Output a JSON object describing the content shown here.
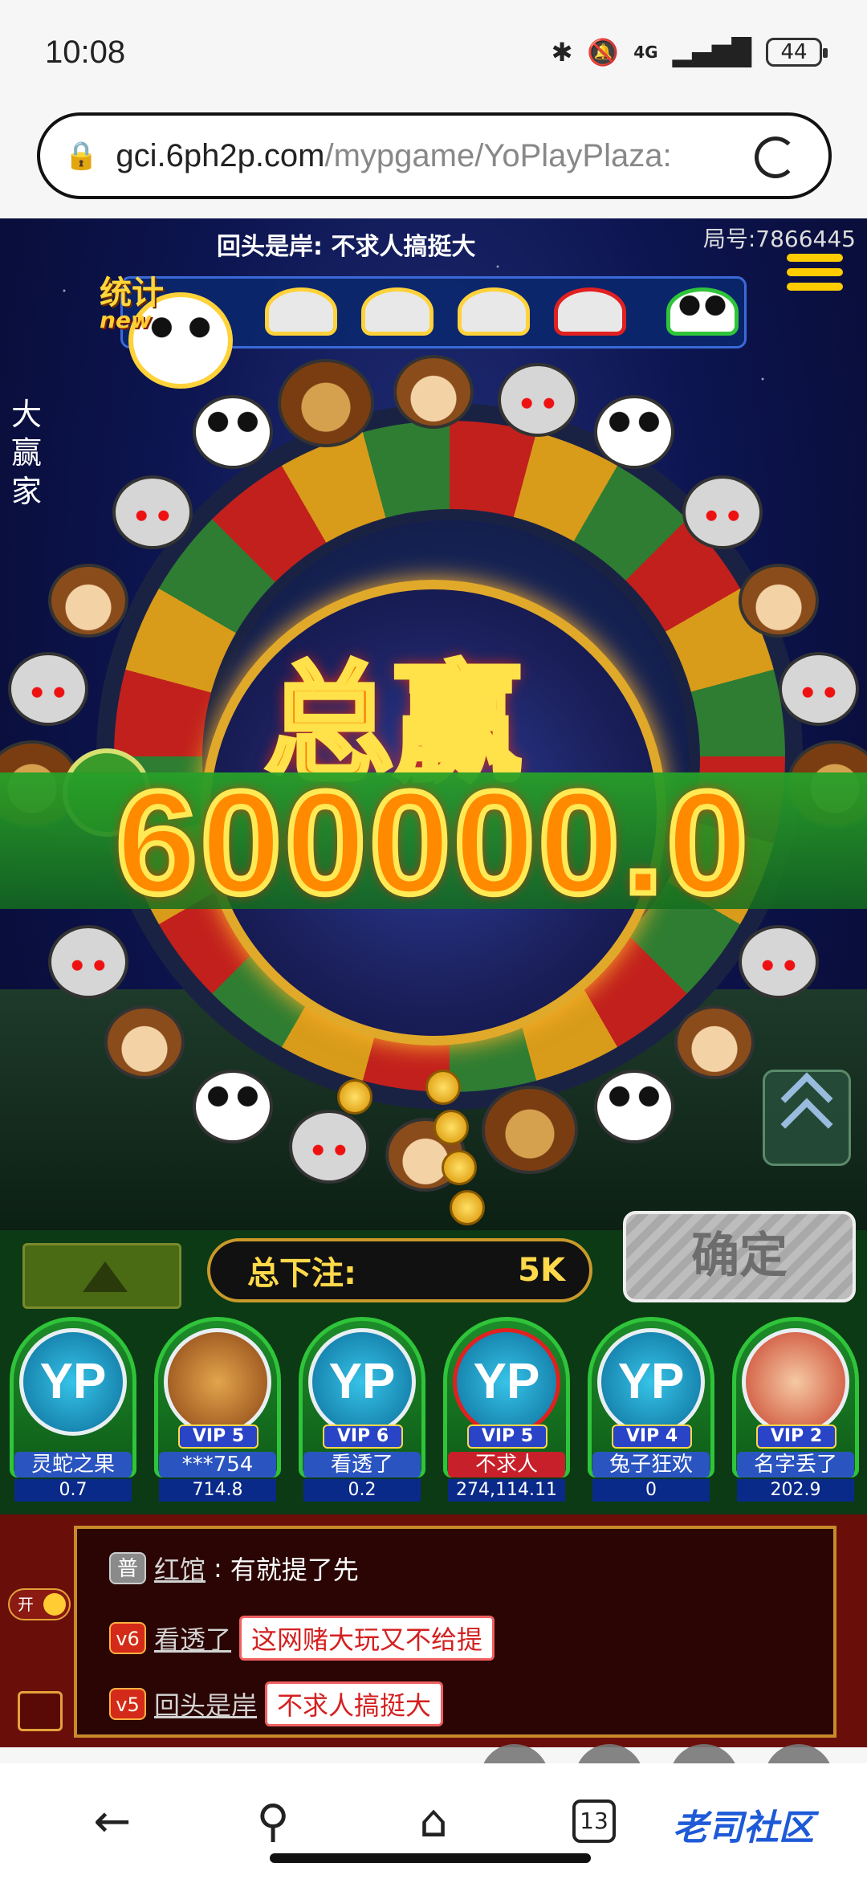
{
  "status_bar": {
    "time": "10:08",
    "network": "4G",
    "battery": "44"
  },
  "browser": {
    "url_host": "gci.6ph2p.com",
    "url_path": "/mypgame/YoPlayPlaza:",
    "tab_count": "13"
  },
  "game": {
    "top_message": "回头是岸: 不求人搞挺大",
    "round_number": "局号:7866445",
    "stats_label": "统计",
    "new_badge": "new",
    "left_tag": "大赢家",
    "win_title": "总赢",
    "win_amount": "600000.0",
    "bet_label": "总下注:",
    "bet_value": "5K",
    "confirm_label": "确定"
  },
  "players": [
    {
      "avatar": "YP",
      "vip": "",
      "name": "灵蛇之果",
      "score": "0.7"
    },
    {
      "avatar": "",
      "vip": "VIP 5",
      "name": "***754",
      "score": "714.8"
    },
    {
      "avatar": "YP",
      "vip": "VIP 6",
      "name": "看透了",
      "score": "0.2"
    },
    {
      "avatar": "YP",
      "vip": "VIP 5",
      "name": "不求人",
      "score": "274,114.11"
    },
    {
      "avatar": "YP",
      "vip": "VIP 4",
      "name": "兔子狂欢",
      "score": "0"
    },
    {
      "avatar": "",
      "vip": "VIP 2",
      "name": "名字丢了",
      "score": "202.9"
    }
  ],
  "chat": {
    "toggle_label": "开",
    "messages": [
      {
        "badge": "普",
        "name": "红馆",
        "text": "有就提了先"
      },
      {
        "badge": "v6",
        "name": "看透了",
        "text": "这网赌大玩又不给提"
      },
      {
        "badge": "v5",
        "name": "回头是岸",
        "text": "不求人搞挺大"
      }
    ]
  },
  "watermark": "老司社区"
}
